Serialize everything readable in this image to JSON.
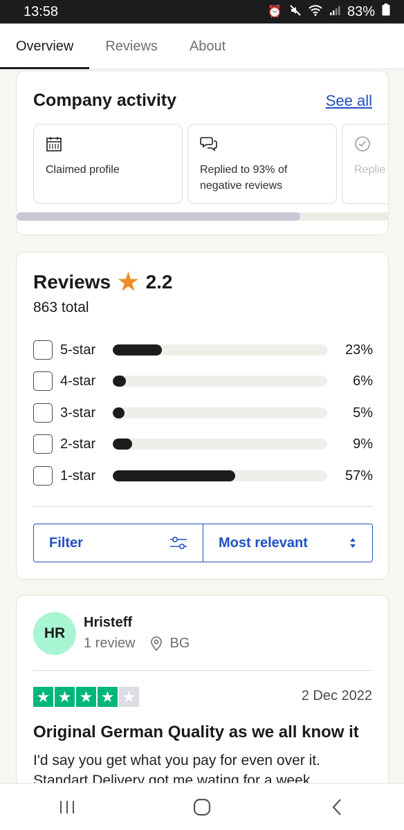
{
  "status_bar": {
    "time": "13:58",
    "battery": "83%",
    "icons": [
      "alarm-icon",
      "mute-icon",
      "wifi-icon",
      "signal-icon",
      "battery-icon"
    ]
  },
  "tabs": [
    {
      "label": "Overview",
      "active": true
    },
    {
      "label": "Reviews",
      "active": false
    },
    {
      "label": "About",
      "active": false
    }
  ],
  "activity": {
    "title": "Company activity",
    "see_all": "See all",
    "items": [
      {
        "icon": "calendar-icon",
        "text": "Claimed profile"
      },
      {
        "icon": "chat-bubbles-icon",
        "text": "Replied to 93% of negative reviews"
      },
      {
        "icon": "clock-icon",
        "text": "Replie review"
      }
    ],
    "scroll_progress": 0.76
  },
  "reviews_summary": {
    "title": "Reviews",
    "rating": "2.2",
    "total": "863 total",
    "rows": [
      {
        "label": "5-star",
        "percent": "23%",
        "value": 23,
        "checked": false
      },
      {
        "label": "4-star",
        "percent": "6%",
        "value": 6,
        "checked": false
      },
      {
        "label": "3-star",
        "percent": "5%",
        "value": 5,
        "checked": false
      },
      {
        "label": "2-star",
        "percent": "9%",
        "value": 9,
        "checked": false
      },
      {
        "label": "1-star",
        "percent": "57%",
        "value": 57,
        "checked": false
      }
    ],
    "filter_label": "Filter",
    "sort_label": "Most relevant"
  },
  "review": {
    "initials": "HR",
    "name": "Hristeff",
    "count": "1 review",
    "country": "BG",
    "stars": 4,
    "star_color": "#00b67a",
    "date": "2 Dec 2022",
    "title": "Original German Quality as we all know it",
    "body": "I'd say you get what you pay for even over it. Standart Delivery got me wating for a week"
  },
  "colors": {
    "accent": "#1f4fc2",
    "star_orange": "#f08a24",
    "avatar_bg": "#a8f5d3",
    "bar_fill": "#1c1c1c"
  }
}
